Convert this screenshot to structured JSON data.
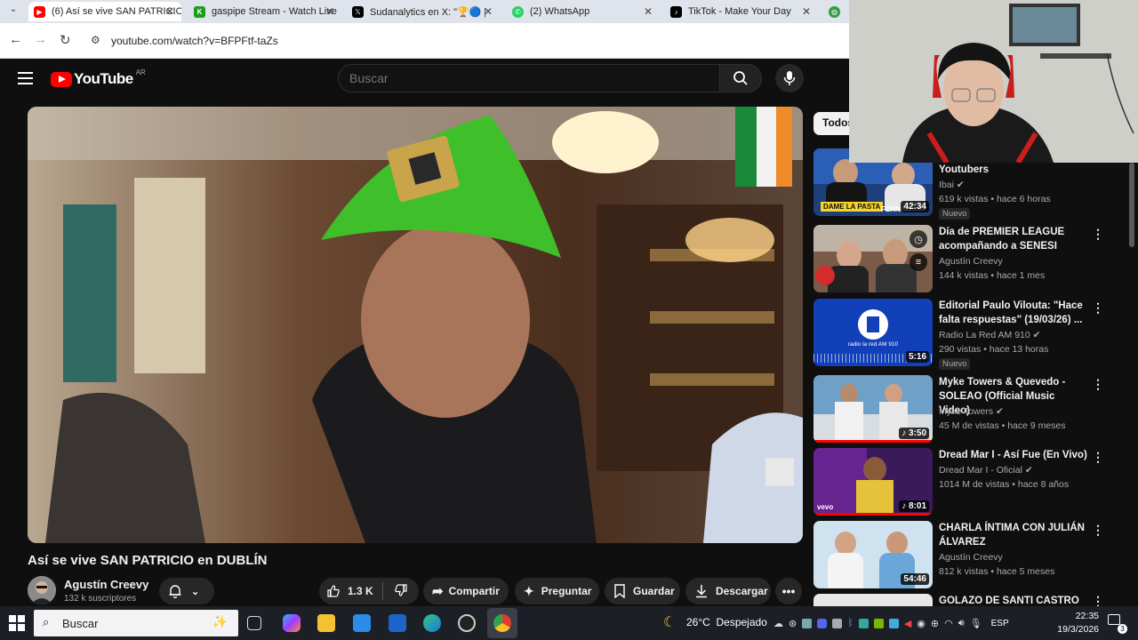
{
  "browser": {
    "tabs": [
      {
        "title": "(6) Así se vive SAN PATRICIO",
        "active": true,
        "icon": "youtube-icon"
      },
      {
        "title": "gaspipe Stream - Watch Live",
        "active": false,
        "icon": "kick-icon"
      },
      {
        "title": "Sudanalytics en X: \"🏆🔵 [C",
        "active": false,
        "icon": "x-icon"
      },
      {
        "title": "(2) WhatsApp",
        "active": false,
        "icon": "whatsapp-icon"
      },
      {
        "title": "TikTok - Make Your Day",
        "active": false,
        "icon": "tiktok-icon"
      }
    ],
    "url": "youtube.com/watch?v=BFPFtf-taZs"
  },
  "youtube": {
    "logo_text": "YouTube",
    "country_code": "AR",
    "search_placeholder": "Buscar"
  },
  "video": {
    "title": "Así se vive SAN PATRICIO en DUBLÍN",
    "channel": "Agustín Creevy",
    "subscribers": "132 k suscriptores",
    "likes": "1.3 K",
    "share_label": "Compartir",
    "ask_label": "Preguntar",
    "save_label": "Guardar",
    "download_label": "Descargar"
  },
  "sidebar": {
    "chip": "Todos",
    "items": [
      {
        "title": "Youtubers",
        "channel": "Ibai",
        "verified": true,
        "meta": "619 k vistas • hace 6 horas",
        "badge": "Nuevo",
        "duration": "42:34"
      },
      {
        "title": "Día de PREMIER LEAGUE acompañando a SENESI",
        "channel": "Agustín Creevy",
        "verified": false,
        "meta": "144 k vistas • hace 1 mes",
        "badge": "",
        "duration": ""
      },
      {
        "title": "Editorial Paulo Vilouta: \"Hace falta respuestas\" (19/03/26) ...",
        "channel": "Radio La Red AM 910",
        "verified": true,
        "meta": "290 vistas • hace 13 horas",
        "badge": "Nuevo",
        "duration": "5:16"
      },
      {
        "title": "Myke Towers & Quevedo - SOLEAO (Official Music Video)",
        "channel": "Myke Towers",
        "verified": true,
        "meta": "45 M de vistas • hace 9 meses",
        "badge": "",
        "duration": "3:50"
      },
      {
        "title": "Dread Mar I - Así Fue (En Vivo)",
        "channel": "Dread Mar I - Oficial",
        "verified": true,
        "meta": "1014 M de vistas • hace 8 años",
        "badge": "",
        "duration": "8:01"
      },
      {
        "title": "CHARLA ÍNTIMA CON JULIÁN ÁLVAREZ",
        "channel": "Agustín Creevy",
        "verified": false,
        "meta": "812 k vistas • hace 5 meses",
        "badge": "",
        "duration": "54:46"
      },
      {
        "title": "GOLAZO DE SANTI CASTRO",
        "channel": "",
        "verified": false,
        "meta": "",
        "badge": "",
        "duration": ""
      }
    ]
  },
  "thumb_labels": {
    "dame_la_pasta": "DAME LA PASTA",
    "fernan": "FERNAN",
    "radio": "radio la red AM 910",
    "vevo": "vevo"
  },
  "taskbar": {
    "search_placeholder": "Buscar",
    "weather": "26°C  Despejado",
    "language": "ESP",
    "time": "22:35",
    "date": "19/3/2026",
    "notification_count": "3"
  }
}
